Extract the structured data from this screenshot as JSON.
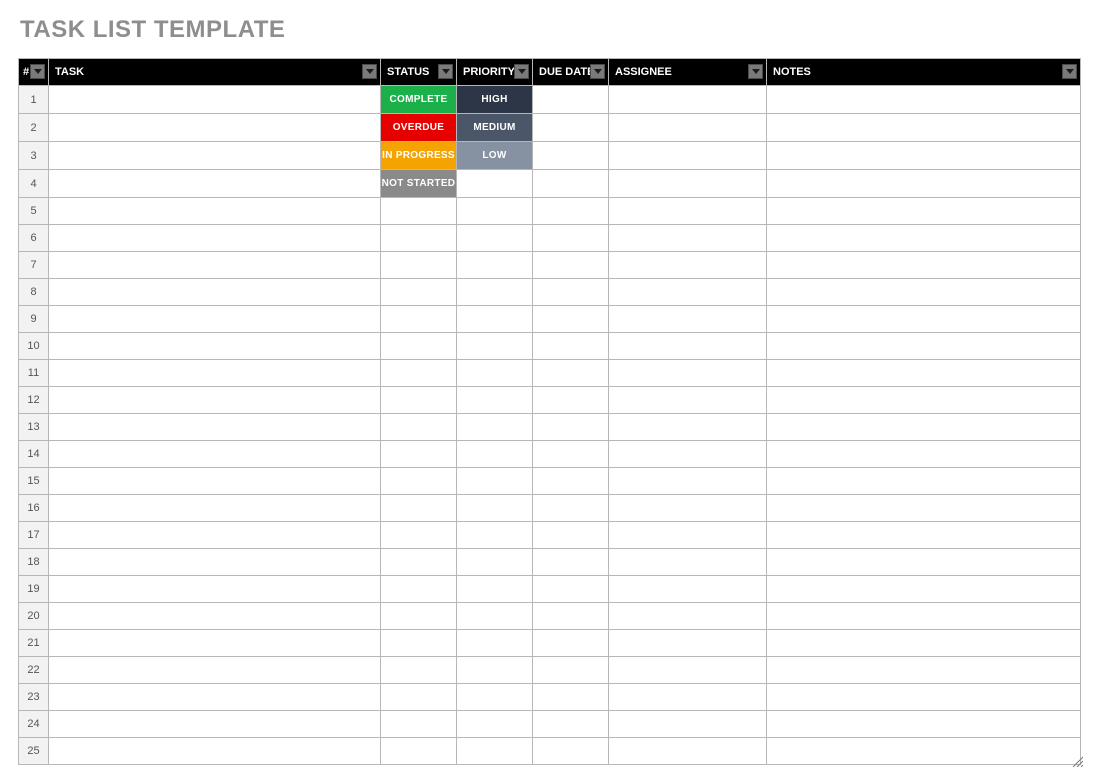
{
  "title": "TASK LIST TEMPLATE",
  "headers": {
    "num": "#",
    "task": "TASK",
    "status": "STATUS",
    "priority": "PRIORITY",
    "duedate": "DUE DATE",
    "assignee": "ASSIGNEE",
    "notes": "NOTES"
  },
  "status_options": {
    "complete": "COMPLETE",
    "overdue": "OVERDUE",
    "in_progress": "IN PROGRESS",
    "not_started": "NOT STARTED"
  },
  "priority_options": {
    "high": "HIGH",
    "medium": "MEDIUM",
    "low": "LOW"
  },
  "rows": [
    {
      "num": "1",
      "task": "",
      "status": "complete",
      "priority": "high",
      "duedate": "",
      "assignee": "",
      "notes": ""
    },
    {
      "num": "2",
      "task": "",
      "status": "overdue",
      "priority": "medium",
      "duedate": "",
      "assignee": "",
      "notes": ""
    },
    {
      "num": "3",
      "task": "",
      "status": "in_progress",
      "priority": "low",
      "duedate": "",
      "assignee": "",
      "notes": ""
    },
    {
      "num": "4",
      "task": "",
      "status": "not_started",
      "priority": "",
      "duedate": "",
      "assignee": "",
      "notes": ""
    },
    {
      "num": "5",
      "task": "",
      "status": "",
      "priority": "",
      "duedate": "",
      "assignee": "",
      "notes": ""
    },
    {
      "num": "6",
      "task": "",
      "status": "",
      "priority": "",
      "duedate": "",
      "assignee": "",
      "notes": ""
    },
    {
      "num": "7",
      "task": "",
      "status": "",
      "priority": "",
      "duedate": "",
      "assignee": "",
      "notes": ""
    },
    {
      "num": "8",
      "task": "",
      "status": "",
      "priority": "",
      "duedate": "",
      "assignee": "",
      "notes": ""
    },
    {
      "num": "9",
      "task": "",
      "status": "",
      "priority": "",
      "duedate": "",
      "assignee": "",
      "notes": ""
    },
    {
      "num": "10",
      "task": "",
      "status": "",
      "priority": "",
      "duedate": "",
      "assignee": "",
      "notes": ""
    },
    {
      "num": "11",
      "task": "",
      "status": "",
      "priority": "",
      "duedate": "",
      "assignee": "",
      "notes": ""
    },
    {
      "num": "12",
      "task": "",
      "status": "",
      "priority": "",
      "duedate": "",
      "assignee": "",
      "notes": ""
    },
    {
      "num": "13",
      "task": "",
      "status": "",
      "priority": "",
      "duedate": "",
      "assignee": "",
      "notes": ""
    },
    {
      "num": "14",
      "task": "",
      "status": "",
      "priority": "",
      "duedate": "",
      "assignee": "",
      "notes": ""
    },
    {
      "num": "15",
      "task": "",
      "status": "",
      "priority": "",
      "duedate": "",
      "assignee": "",
      "notes": ""
    },
    {
      "num": "16",
      "task": "",
      "status": "",
      "priority": "",
      "duedate": "",
      "assignee": "",
      "notes": ""
    },
    {
      "num": "17",
      "task": "",
      "status": "",
      "priority": "",
      "duedate": "",
      "assignee": "",
      "notes": ""
    },
    {
      "num": "18",
      "task": "",
      "status": "",
      "priority": "",
      "duedate": "",
      "assignee": "",
      "notes": ""
    },
    {
      "num": "19",
      "task": "",
      "status": "",
      "priority": "",
      "duedate": "",
      "assignee": "",
      "notes": ""
    },
    {
      "num": "20",
      "task": "",
      "status": "",
      "priority": "",
      "duedate": "",
      "assignee": "",
      "notes": ""
    },
    {
      "num": "21",
      "task": "",
      "status": "",
      "priority": "",
      "duedate": "",
      "assignee": "",
      "notes": ""
    },
    {
      "num": "22",
      "task": "",
      "status": "",
      "priority": "",
      "duedate": "",
      "assignee": "",
      "notes": ""
    },
    {
      "num": "23",
      "task": "",
      "status": "",
      "priority": "",
      "duedate": "",
      "assignee": "",
      "notes": ""
    },
    {
      "num": "24",
      "task": "",
      "status": "",
      "priority": "",
      "duedate": "",
      "assignee": "",
      "notes": ""
    },
    {
      "num": "25",
      "task": "",
      "status": "",
      "priority": "",
      "duedate": "",
      "assignee": "",
      "notes": ""
    }
  ],
  "status_class_map": {
    "complete": "status-complete",
    "overdue": "status-overdue",
    "in_progress": "status-inprogress",
    "not_started": "status-notstarted"
  },
  "priority_class_map": {
    "high": "priority-high",
    "medium": "priority-medium",
    "low": "priority-low"
  }
}
